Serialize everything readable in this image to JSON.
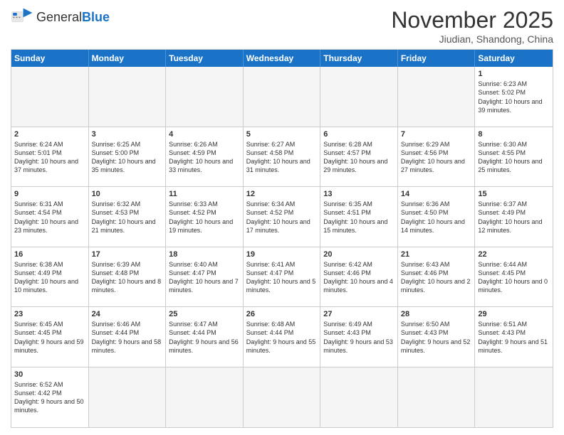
{
  "header": {
    "logo_general": "General",
    "logo_blue": "Blue",
    "month_title": "November 2025",
    "location": "Jiudian, Shandong, China"
  },
  "days": [
    "Sunday",
    "Monday",
    "Tuesday",
    "Wednesday",
    "Thursday",
    "Friday",
    "Saturday"
  ],
  "cells": [
    {
      "day": "",
      "empty": true,
      "info": ""
    },
    {
      "day": "",
      "empty": true,
      "info": ""
    },
    {
      "day": "",
      "empty": true,
      "info": ""
    },
    {
      "day": "",
      "empty": true,
      "info": ""
    },
    {
      "day": "",
      "empty": true,
      "info": ""
    },
    {
      "day": "",
      "empty": true,
      "info": ""
    },
    {
      "day": "1",
      "empty": false,
      "info": "Sunrise: 6:23 AM\nSunset: 5:02 PM\nDaylight: 10 hours and 39 minutes."
    },
    {
      "day": "2",
      "empty": false,
      "info": "Sunrise: 6:24 AM\nSunset: 5:01 PM\nDaylight: 10 hours and 37 minutes."
    },
    {
      "day": "3",
      "empty": false,
      "info": "Sunrise: 6:25 AM\nSunset: 5:00 PM\nDaylight: 10 hours and 35 minutes."
    },
    {
      "day": "4",
      "empty": false,
      "info": "Sunrise: 6:26 AM\nSunset: 4:59 PM\nDaylight: 10 hours and 33 minutes."
    },
    {
      "day": "5",
      "empty": false,
      "info": "Sunrise: 6:27 AM\nSunset: 4:58 PM\nDaylight: 10 hours and 31 minutes."
    },
    {
      "day": "6",
      "empty": false,
      "info": "Sunrise: 6:28 AM\nSunset: 4:57 PM\nDaylight: 10 hours and 29 minutes."
    },
    {
      "day": "7",
      "empty": false,
      "info": "Sunrise: 6:29 AM\nSunset: 4:56 PM\nDaylight: 10 hours and 27 minutes."
    },
    {
      "day": "8",
      "empty": false,
      "info": "Sunrise: 6:30 AM\nSunset: 4:55 PM\nDaylight: 10 hours and 25 minutes."
    },
    {
      "day": "9",
      "empty": false,
      "info": "Sunrise: 6:31 AM\nSunset: 4:54 PM\nDaylight: 10 hours and 23 minutes."
    },
    {
      "day": "10",
      "empty": false,
      "info": "Sunrise: 6:32 AM\nSunset: 4:53 PM\nDaylight: 10 hours and 21 minutes."
    },
    {
      "day": "11",
      "empty": false,
      "info": "Sunrise: 6:33 AM\nSunset: 4:52 PM\nDaylight: 10 hours and 19 minutes."
    },
    {
      "day": "12",
      "empty": false,
      "info": "Sunrise: 6:34 AM\nSunset: 4:52 PM\nDaylight: 10 hours and 17 minutes."
    },
    {
      "day": "13",
      "empty": false,
      "info": "Sunrise: 6:35 AM\nSunset: 4:51 PM\nDaylight: 10 hours and 15 minutes."
    },
    {
      "day": "14",
      "empty": false,
      "info": "Sunrise: 6:36 AM\nSunset: 4:50 PM\nDaylight: 10 hours and 14 minutes."
    },
    {
      "day": "15",
      "empty": false,
      "info": "Sunrise: 6:37 AM\nSunset: 4:49 PM\nDaylight: 10 hours and 12 minutes."
    },
    {
      "day": "16",
      "empty": false,
      "info": "Sunrise: 6:38 AM\nSunset: 4:49 PM\nDaylight: 10 hours and 10 minutes."
    },
    {
      "day": "17",
      "empty": false,
      "info": "Sunrise: 6:39 AM\nSunset: 4:48 PM\nDaylight: 10 hours and 8 minutes."
    },
    {
      "day": "18",
      "empty": false,
      "info": "Sunrise: 6:40 AM\nSunset: 4:47 PM\nDaylight: 10 hours and 7 minutes."
    },
    {
      "day": "19",
      "empty": false,
      "info": "Sunrise: 6:41 AM\nSunset: 4:47 PM\nDaylight: 10 hours and 5 minutes."
    },
    {
      "day": "20",
      "empty": false,
      "info": "Sunrise: 6:42 AM\nSunset: 4:46 PM\nDaylight: 10 hours and 4 minutes."
    },
    {
      "day": "21",
      "empty": false,
      "info": "Sunrise: 6:43 AM\nSunset: 4:46 PM\nDaylight: 10 hours and 2 minutes."
    },
    {
      "day": "22",
      "empty": false,
      "info": "Sunrise: 6:44 AM\nSunset: 4:45 PM\nDaylight: 10 hours and 0 minutes."
    },
    {
      "day": "23",
      "empty": false,
      "info": "Sunrise: 6:45 AM\nSunset: 4:45 PM\nDaylight: 9 hours and 59 minutes."
    },
    {
      "day": "24",
      "empty": false,
      "info": "Sunrise: 6:46 AM\nSunset: 4:44 PM\nDaylight: 9 hours and 58 minutes."
    },
    {
      "day": "25",
      "empty": false,
      "info": "Sunrise: 6:47 AM\nSunset: 4:44 PM\nDaylight: 9 hours and 56 minutes."
    },
    {
      "day": "26",
      "empty": false,
      "info": "Sunrise: 6:48 AM\nSunset: 4:44 PM\nDaylight: 9 hours and 55 minutes."
    },
    {
      "day": "27",
      "empty": false,
      "info": "Sunrise: 6:49 AM\nSunset: 4:43 PM\nDaylight: 9 hours and 53 minutes."
    },
    {
      "day": "28",
      "empty": false,
      "info": "Sunrise: 6:50 AM\nSunset: 4:43 PM\nDaylight: 9 hours and 52 minutes."
    },
    {
      "day": "29",
      "empty": false,
      "info": "Sunrise: 6:51 AM\nSunset: 4:43 PM\nDaylight: 9 hours and 51 minutes."
    },
    {
      "day": "30",
      "empty": false,
      "info": "Sunrise: 6:52 AM\nSunset: 4:42 PM\nDaylight: 9 hours and 50 minutes."
    },
    {
      "day": "",
      "empty": true,
      "info": ""
    },
    {
      "day": "",
      "empty": true,
      "info": ""
    },
    {
      "day": "",
      "empty": true,
      "info": ""
    },
    {
      "day": "",
      "empty": true,
      "info": ""
    },
    {
      "day": "",
      "empty": true,
      "info": ""
    },
    {
      "day": "",
      "empty": true,
      "info": ""
    }
  ]
}
